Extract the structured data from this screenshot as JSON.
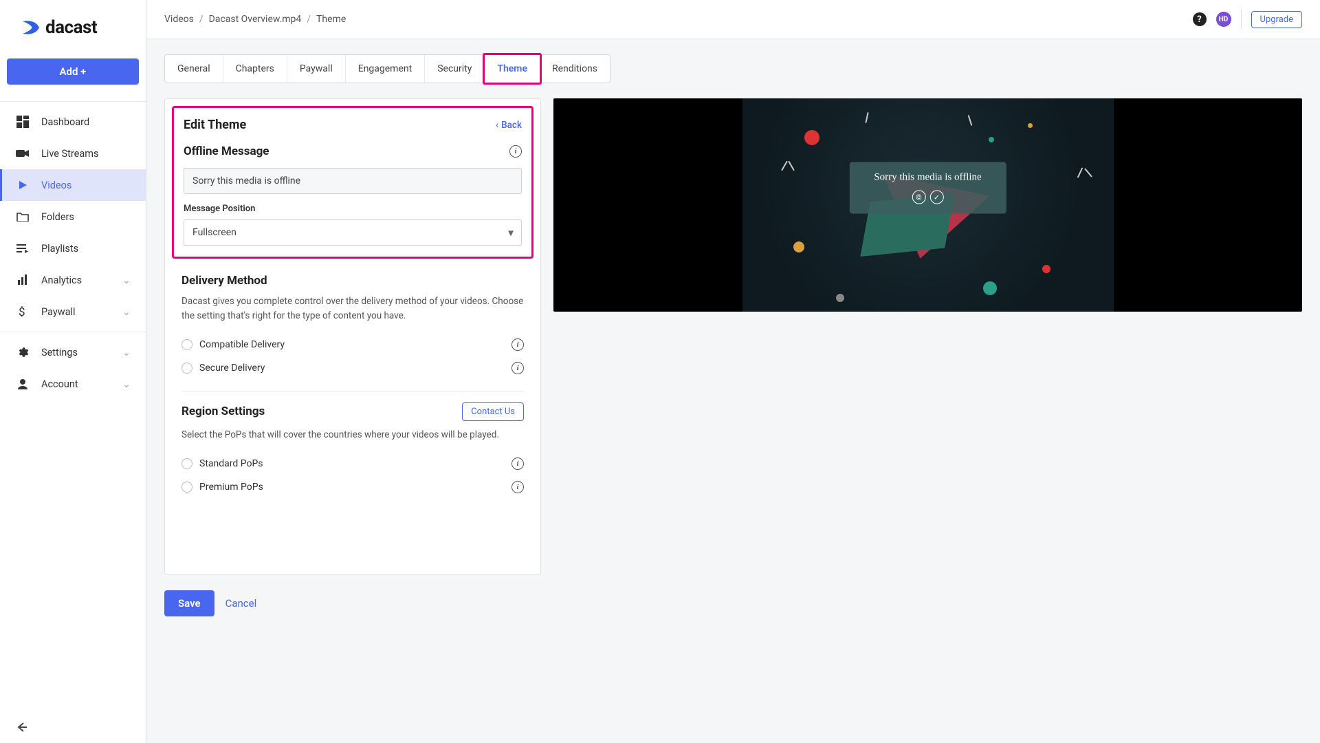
{
  "brand": {
    "name": "dacast"
  },
  "sidebar": {
    "add_label": "Add +",
    "items": [
      {
        "label": "Dashboard"
      },
      {
        "label": "Live Streams"
      },
      {
        "label": "Videos"
      },
      {
        "label": "Folders"
      },
      {
        "label": "Playlists"
      },
      {
        "label": "Analytics",
        "expandable": true
      },
      {
        "label": "Paywall",
        "expandable": true
      },
      {
        "label": "Settings",
        "expandable": true
      },
      {
        "label": "Account",
        "expandable": true
      }
    ]
  },
  "breadcrumb": [
    "Videos",
    "Dacast Overview.mp4",
    "Theme"
  ],
  "header": {
    "avatar_initials": "HD",
    "upgrade_label": "Upgrade"
  },
  "tabs": [
    "General",
    "Chapters",
    "Paywall",
    "Engagement",
    "Security",
    "Theme",
    "Renditions"
  ],
  "form": {
    "title": "Edit Theme",
    "back_label": "Back",
    "offline": {
      "heading": "Offline Message",
      "value": "Sorry this media is offline",
      "position_label": "Message Position",
      "position_value": "Fullscreen"
    },
    "delivery": {
      "heading": "Delivery Method",
      "desc": "Dacast gives you complete control over the delivery method of your videos. Choose the setting that's right for the type of content you have.",
      "options": [
        "Compatible Delivery",
        "Secure Delivery"
      ]
    },
    "region": {
      "heading": "Region Settings",
      "contact_label": "Contact Us",
      "desc": "Select the PoPs that will cover the countries where your videos will be played.",
      "options": [
        "Standard PoPs",
        "Premium PoPs"
      ]
    },
    "save_label": "Save",
    "cancel_label": "Cancel"
  },
  "preview": {
    "offline_text": "Sorry this media is offline"
  }
}
